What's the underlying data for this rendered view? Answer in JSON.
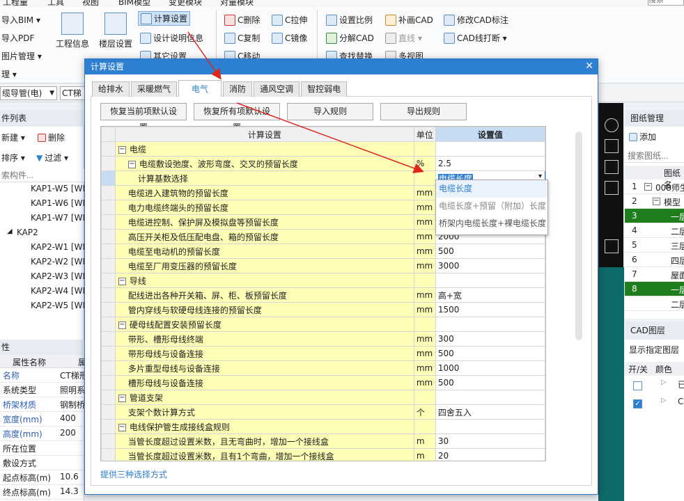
{
  "menu": {
    "items": [
      "工程量",
      "工具",
      "视图",
      "BIM模型",
      "变更模块",
      "对量模块"
    ],
    "search_placeholder": "搜索"
  },
  "ribbon": {
    "left_items": [
      "导入BIM ▾",
      "导入PDF",
      "图片管理 ▾",
      "理 ▾"
    ],
    "big_buttons": [
      "工程信息",
      "楼层设置"
    ],
    "settings": [
      "计算设置",
      "设计说明信息",
      "其它设置"
    ],
    "cad_group1": [
      "C删除",
      "C拉伸",
      "C复制",
      "C镜像",
      "C移动"
    ],
    "cad_group2": [
      "设置比例",
      "补画CAD",
      "修改CAD标注",
      "分解CAD",
      "直线 ▾",
      "CAD线打断 ▾",
      "查找替换",
      "多视图"
    ]
  },
  "filters": {
    "first": "缆导管(电)",
    "second": "CT梯架"
  },
  "left_panel": {
    "title": "件列表",
    "toolbar": [
      "新建 ▾",
      "删除",
      "排序 ▾",
      "过滤 ▾"
    ],
    "search_placeholder": "索构件...",
    "items": [
      "KAP1-W5 [WD",
      "KAP1-W6 [WD",
      "KAP1-W7 [WD",
      "KAP2",
      "KAP2-W1 [WD",
      "KAP2-W2 [WD",
      "KAP2-W3 [WD",
      "KAP2-W4 [WD",
      "KAP2-W5 [WD"
    ]
  },
  "prop_panel": {
    "title": "性",
    "headers": [
      "属性名称",
      "属"
    ],
    "rows": [
      [
        "名称",
        "CT梯形"
      ],
      [
        "系统类型",
        "照明系"
      ],
      [
        "桥架材质",
        "钢制桥"
      ],
      [
        "宽度(mm)",
        "400"
      ],
      [
        "高度(mm)",
        "200"
      ],
      [
        "所在位置",
        ""
      ],
      [
        "敷设方式",
        ""
      ],
      [
        "起点标高(m)",
        "10.6"
      ],
      [
        "终点标高(m)",
        "14.3"
      ]
    ]
  },
  "right_panel": {
    "title": "图纸管理",
    "add_label": "添加",
    "search_placeholder": "搜索图纸...",
    "col_header": "图纸名",
    "rows": [
      [
        "1",
        "008师生"
      ],
      [
        "2",
        "模型"
      ],
      [
        "3",
        "一层"
      ],
      [
        "4",
        "二层"
      ],
      [
        "5",
        "三层"
      ],
      [
        "6",
        "四层"
      ],
      [
        "7",
        "屋面"
      ],
      [
        "8",
        "一层"
      ],
      [
        "",
        "二层"
      ]
    ],
    "cad_title": "CAD图层",
    "cad_show": "显示指定图层",
    "cad_headers": [
      "开/关",
      "颜色"
    ],
    "cad_rows": [
      "已",
      "C"
    ]
  },
  "dialog": {
    "title": "计算设置",
    "tabs": [
      "给排水",
      "采暖燃气",
      "电气",
      "消防",
      "通风空调",
      "智控弱电"
    ],
    "buttons": [
      "恢复当前项默认设置",
      "恢复所有项默认设置",
      "导入规则",
      "导出规则"
    ],
    "headers": [
      "计算设置",
      "单位",
      "设置值"
    ],
    "rows": [
      {
        "label": "电缆",
        "unit": "",
        "value": "",
        "level": 0,
        "tog": "−",
        "grp": true
      },
      {
        "label": "电缆敷设弛度、波形弯度、交叉的预留长度",
        "unit": "%",
        "value": "2.5",
        "level": 1,
        "tog": "−",
        "grp": true
      },
      {
        "label": "计算基数选择",
        "unit": "",
        "value": "",
        "level": 2,
        "tog": "",
        "grp": false,
        "sel": true
      },
      {
        "label": "电缆进入建筑物的预留长度",
        "unit": "mm",
        "value": "",
        "level": 1,
        "tog": "",
        "grp": false
      },
      {
        "label": "电力电缆终端头的预留长度",
        "unit": "mm",
        "value": "",
        "level": 1,
        "tog": "",
        "grp": false
      },
      {
        "label": "电缆进控制、保护屏及模拟盘等预留长度",
        "unit": "mm",
        "value": "",
        "level": 1,
        "tog": "",
        "grp": false
      },
      {
        "label": "高压开关柜及低压配电盘、箱的预留长度",
        "unit": "mm",
        "value": "2000",
        "level": 1,
        "tog": "",
        "grp": false
      },
      {
        "label": "电缆至电动机的预留长度",
        "unit": "mm",
        "value": "500",
        "level": 1,
        "tog": "",
        "grp": false
      },
      {
        "label": "电缆至厂用变压器的预留长度",
        "unit": "mm",
        "value": "3000",
        "level": 1,
        "tog": "",
        "grp": false
      },
      {
        "label": "导线",
        "unit": "",
        "value": "",
        "level": 0,
        "tog": "−",
        "grp": true
      },
      {
        "label": "配线进出各种开关箱、屏、柜、板预留长度",
        "unit": "mm",
        "value": "高+宽",
        "level": 1,
        "tog": "",
        "grp": false
      },
      {
        "label": "管内穿线与软硬母线连接的预留长度",
        "unit": "mm",
        "value": "1500",
        "level": 1,
        "tog": "",
        "grp": false
      },
      {
        "label": "硬母线配置安装预留长度",
        "unit": "",
        "value": "",
        "level": 0,
        "tog": "−",
        "grp": true
      },
      {
        "label": "带形、槽形母线终端",
        "unit": "mm",
        "value": "300",
        "level": 1,
        "tog": "",
        "grp": false
      },
      {
        "label": "带形母线与设备连接",
        "unit": "mm",
        "value": "500",
        "level": 1,
        "tog": "",
        "grp": false
      },
      {
        "label": "多片重型母线与设备连接",
        "unit": "mm",
        "value": "1000",
        "level": 1,
        "tog": "",
        "grp": false
      },
      {
        "label": "槽形母线与设备连接",
        "unit": "mm",
        "value": "500",
        "level": 1,
        "tog": "",
        "grp": false
      },
      {
        "label": "管道支架",
        "unit": "",
        "value": "",
        "level": 0,
        "tog": "−",
        "grp": true
      },
      {
        "label": "支架个数计算方式",
        "unit": "个",
        "value": "四舍五入",
        "level": 1,
        "tog": "",
        "grp": false
      },
      {
        "label": "电线保护管生成接线盒规则",
        "unit": "",
        "value": "",
        "level": 0,
        "tog": "−",
        "grp": true
      },
      {
        "label": "当管长度超过设置米数，且无弯曲时，增加一个接线盒",
        "unit": "m",
        "value": "30",
        "level": 1,
        "tog": "",
        "grp": false
      },
      {
        "label": "当管长度超过设置米数，且有1个弯曲，增加一个接线盒",
        "unit": "m",
        "value": "20",
        "level": 1,
        "tog": "",
        "grp": false
      }
    ],
    "selected_value": "电缆长度",
    "dropdown_options": [
      "电缆长度",
      "电缆长度+预留（附加）长度",
      "桥架内电缆长度+裸电缆长度"
    ],
    "footer_hint": "提供三种选择方式"
  },
  "colors": {
    "accent": "#2d7fd2",
    "highlight_row": "#fdfdb5",
    "selection": "#1e7e1e",
    "arrow": "#e0251b"
  }
}
